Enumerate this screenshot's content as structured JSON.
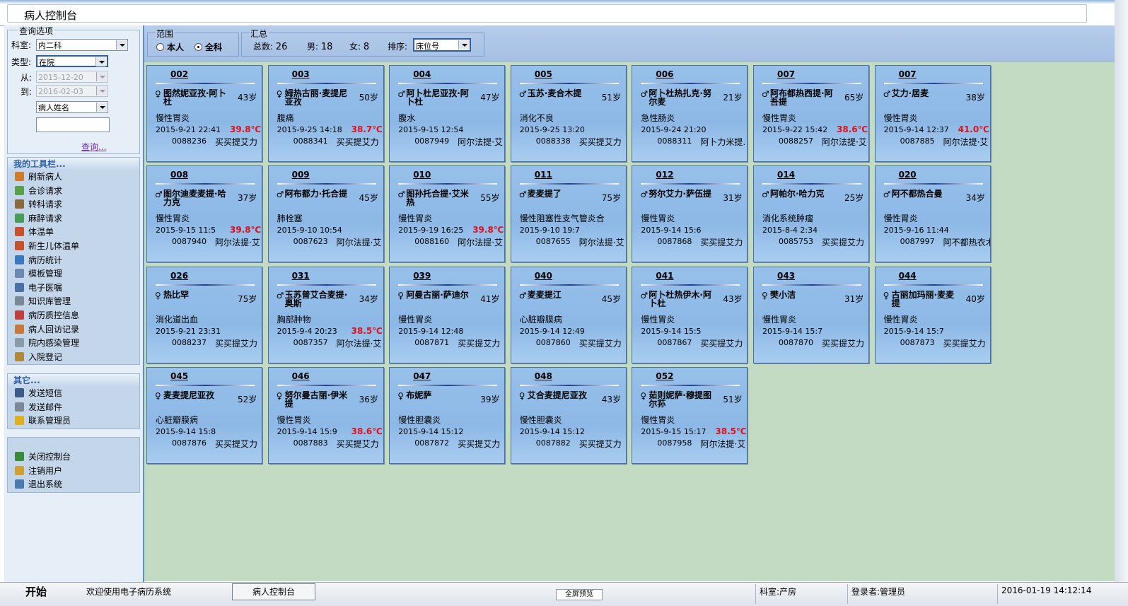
{
  "window": {
    "title": "病人控制台"
  },
  "query": {
    "group_label": "查询选项",
    "dept_label": "科室:",
    "dept_value": "内二科",
    "type_label": "类型:",
    "type_value": "在院",
    "from_label": "从:",
    "from_value": "2015-12-20",
    "to_label": "到:",
    "to_value": "2016-02-03",
    "field_value": "病人姓名",
    "search_value": "",
    "query_link": "查询..."
  },
  "toolbar": {
    "title": "我的工具栏...",
    "items": [
      {
        "label": "刷新病人",
        "icon": "refresh-patients-icon",
        "color": "#d07a2a"
      },
      {
        "label": "会诊请求",
        "icon": "consult-icon",
        "color": "#5aa04a"
      },
      {
        "label": "转科请求",
        "icon": "transfer-icon",
        "color": "#8a6a3a"
      },
      {
        "label": "麻醉请求",
        "icon": "anesthesia-icon",
        "color": "#4a9a5a"
      },
      {
        "label": "体温单",
        "icon": "temperature-chart-icon",
        "color": "#c8502a"
      },
      {
        "label": "新生儿体温单",
        "icon": "newborn-chart-icon",
        "color": "#c8502a"
      },
      {
        "label": "病历统计",
        "icon": "record-stats-icon",
        "color": "#3a78c0"
      },
      {
        "label": "模板管理",
        "icon": "template-icon",
        "color": "#6a8ab0"
      },
      {
        "label": "电子医嘱",
        "icon": "e-order-icon",
        "color": "#4a70a8"
      },
      {
        "label": "知识库管理",
        "icon": "knowledge-base-icon",
        "color": "#7a8898"
      },
      {
        "label": "病历质控信息",
        "icon": "quality-control-icon",
        "color": "#c04040"
      },
      {
        "label": "病人回访记录",
        "icon": "followup-icon",
        "color": "#c8783a"
      },
      {
        "label": "院内感染管理",
        "icon": "infection-icon",
        "color": "#8a9aa8"
      },
      {
        "label": "入院登记",
        "icon": "admission-icon",
        "color": "#b08a3a"
      }
    ]
  },
  "others": {
    "title": "其它...",
    "items": [
      {
        "label": "发送短信",
        "icon": "sms-icon",
        "color": "#3a5a8a"
      },
      {
        "label": "发送邮件",
        "icon": "mail-icon",
        "color": "#7a8898"
      },
      {
        "label": "联系管理员",
        "icon": "bell-icon",
        "color": "#e0b020"
      }
    ]
  },
  "system": {
    "items": [
      {
        "label": "关闭控制台",
        "icon": "close-console-icon",
        "color": "#3a8a3a"
      },
      {
        "label": "注销用户",
        "icon": "logout-user-icon",
        "color": "#d0a030"
      },
      {
        "label": "退出系统",
        "icon": "exit-icon",
        "color": "#4a7ab0"
      }
    ]
  },
  "scope": {
    "label": "范围",
    "opt_self": "本人",
    "opt_all": "全科",
    "selected": "全科"
  },
  "summary": {
    "label": "汇总",
    "total_label": "总数:",
    "total": "26",
    "male_label": "男:",
    "male": "18",
    "female_label": "女:",
    "female": "8",
    "sort_label": "排序:",
    "sort_value": "床位号"
  },
  "patients": [
    {
      "bed": "002",
      "sex": "♀",
      "name": "图然妮亚孜·阿卜杜",
      "age": "43岁",
      "diag": "慢性胃炎",
      "date": "2015-9-21 22:41",
      "temp": "39.8℃",
      "pid": "0088236",
      "doctor": "买买提艾力"
    },
    {
      "bed": "003",
      "sex": "♀",
      "name": "姆热古丽·麦提尼亚孜",
      "age": "50岁",
      "diag": "腹痛",
      "date": "2015-9-25 14:18",
      "temp": "38.7℃",
      "pid": "0088341",
      "doctor": "买买提艾力"
    },
    {
      "bed": "004",
      "sex": "♂",
      "name": "阿卜杜尼亚孜·阿卜杜",
      "age": "47岁",
      "diag": "腹水",
      "date": "2015-9-15 12:54",
      "temp": "",
      "pid": "0087949",
      "doctor": "阿尔法提·艾"
    },
    {
      "bed": "005",
      "sex": "♂",
      "name": "玉苏·麦合木提",
      "age": "51岁",
      "diag": "消化不良",
      "date": "2015-9-25 13:20",
      "temp": "",
      "pid": "0088338",
      "doctor": "买买提艾力"
    },
    {
      "bed": "006",
      "sex": "♂",
      "name": "阿卜杜热扎克·努尔麦",
      "age": "21岁",
      "diag": "急性肠炎",
      "date": "2015-9-24 21:20",
      "temp": "",
      "pid": "0088311",
      "doctor": "阿卜力米提.肖"
    },
    {
      "bed": "007",
      "sex": "♂",
      "name": "阿布都热西提·阿吾提",
      "age": "65岁",
      "diag": "慢性胃炎",
      "date": "2015-9-22 15:42",
      "temp": "38.6℃",
      "pid": "0088257",
      "doctor": "阿尔法提·艾"
    },
    {
      "bed": "007",
      "sex": "♂",
      "name": "艾力·居麦",
      "age": "38岁",
      "diag": "慢性胃炎",
      "date": "2015-9-14 12:37",
      "temp": "41.0℃",
      "pid": "0087885",
      "doctor": "阿尔法提·艾"
    },
    {
      "bed": "008",
      "sex": "♂",
      "name": "图尔迪麦麦提·哈力克",
      "age": "37岁",
      "diag": "慢性胃炎",
      "date": "2015-9-15 11:5",
      "temp": "39.8℃",
      "pid": "0087940",
      "doctor": "阿尔法提·艾"
    },
    {
      "bed": "009",
      "sex": "♂",
      "name": "阿布都力·托合提",
      "age": "45岁",
      "diag": "肺栓塞",
      "date": "2015-9-10 10:54",
      "temp": "",
      "pid": "0087623",
      "doctor": "阿尔法提·艾"
    },
    {
      "bed": "010",
      "sex": "♂",
      "name": "图孙托合提·艾米热",
      "age": "55岁",
      "diag": "慢性胃炎",
      "date": "2015-9-19 16:25",
      "temp": "39.8℃",
      "pid": "0088160",
      "doctor": "阿尔法提·艾"
    },
    {
      "bed": "011",
      "sex": "♂",
      "name": "麦麦提了",
      "age": "75岁",
      "diag": "慢性阻塞性支气管炎合",
      "date": "2015-9-10 19:7",
      "temp": "",
      "pid": "0087655",
      "doctor": "阿尔法提·艾"
    },
    {
      "bed": "012",
      "sex": "♂",
      "name": "努尔艾力·萨伍提",
      "age": "31岁",
      "diag": "慢性胃炎",
      "date": "2015-9-14 15:6",
      "temp": "",
      "pid": "0087868",
      "doctor": "买买提艾力"
    },
    {
      "bed": "014",
      "sex": "♂",
      "name": "阿帕尔·哈力克",
      "age": "25岁",
      "diag": "消化系统肿瘤",
      "date": "2015-8-4 2:34",
      "temp": "",
      "pid": "0085753",
      "doctor": "买买提艾力"
    },
    {
      "bed": "020",
      "sex": "♂",
      "name": "阿不都热合曼",
      "age": "34岁",
      "diag": "慢性胃炎",
      "date": "2015-9-16 11:44",
      "temp": "",
      "pid": "0087997",
      "doctor": "阿不都热衣木"
    },
    {
      "bed": "026",
      "sex": "♀",
      "name": "热比罕",
      "age": "75岁",
      "diag": "消化道出血",
      "date": "2015-9-21 23:31",
      "temp": "",
      "pid": "0088237",
      "doctor": "买买提艾力"
    },
    {
      "bed": "031",
      "sex": "♂",
      "name": "玉苏普艾合麦提·奥斯",
      "age": "34岁",
      "diag": "胸部肿物",
      "date": "2015-9-4 20:23",
      "temp": "38.5℃",
      "pid": "0087357",
      "doctor": "阿尔法提·艾"
    },
    {
      "bed": "039",
      "sex": "♀",
      "name": "阿曼古丽·萨迪尔",
      "age": "41岁",
      "diag": "慢性胃炎",
      "date": "2015-9-14 12:48",
      "temp": "",
      "pid": "0087871",
      "doctor": "买买提艾力"
    },
    {
      "bed": "040",
      "sex": "♂",
      "name": "麦麦提江",
      "age": "45岁",
      "diag": "心脏瓣膜病",
      "date": "2015-9-14 12:49",
      "temp": "",
      "pid": "0087860",
      "doctor": "买买提艾力"
    },
    {
      "bed": "041",
      "sex": "♂",
      "name": "阿卜杜热伊木·阿卜杜",
      "age": "43岁",
      "diag": "慢性胃炎",
      "date": "2015-9-14 15:5",
      "temp": "",
      "pid": "0087867",
      "doctor": "买买提艾力"
    },
    {
      "bed": "043",
      "sex": "♀",
      "name": "樊小洁",
      "age": "31岁",
      "diag": "慢性胃炎",
      "date": "2015-9-14 15:7",
      "temp": "",
      "pid": "0087870",
      "doctor": "买买提艾力"
    },
    {
      "bed": "044",
      "sex": "♀",
      "name": "古丽加玛丽·麦麦提",
      "age": "40岁",
      "diag": "慢性胃炎",
      "date": "2015-9-14 15:7",
      "temp": "",
      "pid": "0087873",
      "doctor": "买买提艾力"
    },
    {
      "bed": "045",
      "sex": "♀",
      "name": "麦麦提尼亚孜",
      "age": "52岁",
      "diag": "心脏瓣膜病",
      "date": "2015-9-14 15:8",
      "temp": "",
      "pid": "0087876",
      "doctor": "买买提艾力"
    },
    {
      "bed": "046",
      "sex": "♀",
      "name": "努尔曼古丽·伊米提",
      "age": "36岁",
      "diag": "慢性胃炎",
      "date": "2015-9-14 15:9",
      "temp": "38.6℃",
      "pid": "0087883",
      "doctor": "买买提艾力"
    },
    {
      "bed": "047",
      "sex": "♀",
      "name": "布妮萨",
      "age": "39岁",
      "diag": "慢性胆囊炎",
      "date": "2015-9-14 15:12",
      "temp": "",
      "pid": "0087872",
      "doctor": "买买提艾力"
    },
    {
      "bed": "048",
      "sex": "♀",
      "name": "艾合麦提尼亚孜",
      "age": "43岁",
      "diag": "慢性胆囊炎",
      "date": "2015-9-14 15:12",
      "temp": "",
      "pid": "0087882",
      "doctor": "买买提艾力"
    },
    {
      "bed": "052",
      "sex": "♀",
      "name": "茹则妮萨·穆提图尔荪",
      "age": "51岁",
      "diag": "慢性胃炎",
      "date": "2015-9-15 15:17",
      "temp": "38.5℃",
      "pid": "0087958",
      "doctor": "阿尔法提·艾"
    }
  ],
  "status": {
    "start": "开始",
    "welcome": "欢迎使用电子病历系统",
    "active_tab": "病人控制台",
    "mini_button": "全屏预览",
    "dept": "科室:产房",
    "user": "登录者:管理员",
    "datetime": "2016-01-19 14:12:14"
  }
}
